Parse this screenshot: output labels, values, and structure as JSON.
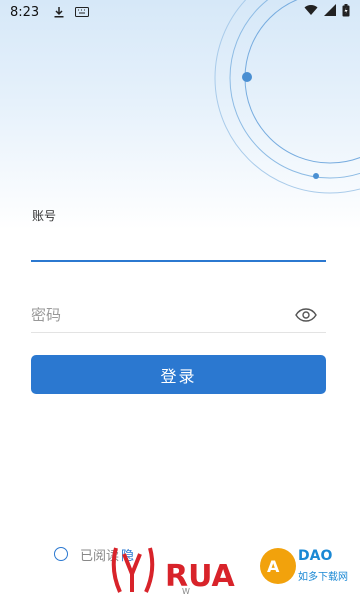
{
  "status_bar": {
    "time": "8:23",
    "download_icon": "download-icon",
    "keyboard_icon": "keyboard-icon",
    "wifi_icon": "wifi-icon",
    "signal_icon": "signal-icon",
    "battery_icon": "battery-charging-icon"
  },
  "login": {
    "account_label": "账号",
    "account_value": "",
    "password_placeholder": "密码",
    "password_value": "",
    "eye_icon": "eye-icon",
    "submit_label": "登录"
  },
  "agreement": {
    "text": "已阅读",
    "link_text": "隐",
    "checked": false
  },
  "watermark": {
    "brand": "RUADAO",
    "site": "www.ruadao.com",
    "cn_text": "如多下载网"
  },
  "colors": {
    "primary": "#2b78d0",
    "gradient_top": "#d6e8f8",
    "muted_text": "#888888"
  }
}
